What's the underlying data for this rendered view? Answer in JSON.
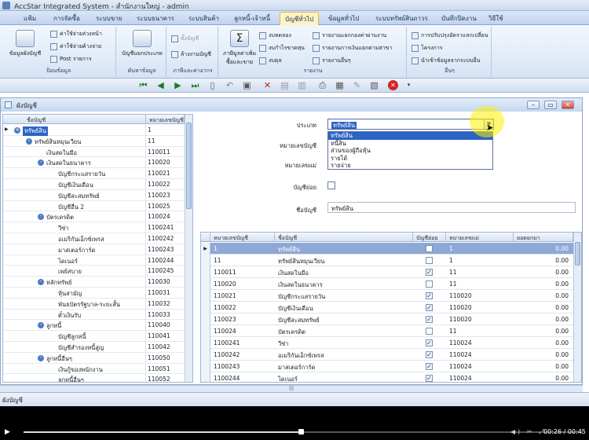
{
  "window": {
    "title": "AccStar Integrated System - สำนักงานใหญ่ - admin"
  },
  "menu": [
    {
      "label": "แฟ้ม"
    },
    {
      "label": "การจัดซื้อ"
    },
    {
      "label": "ระบบขาย"
    },
    {
      "label": "ระบบธนาคาร"
    },
    {
      "label": "ระบบสินค้า"
    },
    {
      "label": "ลูกหนี้-เจ้าหนี้"
    },
    {
      "label": "บัญชีทั่วไป"
    },
    {
      "label": "ข้อมูลทั่วไป"
    },
    {
      "label": "ระบบทรัพย์สินถาวร"
    },
    {
      "label": "บันทึกปิดงาน"
    },
    {
      "label": "วิธีใช้"
    }
  ],
  "ribbon": {
    "g1": {
      "big": "ข้อมูลผังบัญชี",
      "small": [
        "ค่าใช้จ่ายล่วงหน้า",
        "ค่าใช้จ่ายค้างจ่าย",
        "Post รายการ"
      ],
      "label": "ป้อนข้อมูล"
    },
    "g2": {
      "big": "บัญชีแยกประเภท",
      "label": "ค้นหาข้อมูล"
    },
    "g3": {
      "small": [
        "ตั้งบัญชี",
        "ล้างงานบัญชี"
      ],
      "label": "ภาษีและค่าอากร"
    },
    "g4": {
      "big": "ภาษีมูลค่าเพิ่ม ซื้อและขาย",
      "small": [
        "งบทดลอง",
        "งบกำไรขาดทุน",
        "งบดุล"
      ],
      "small2": [
        "รายงานแยกกองค่าผ่านงาน",
        "รายงานการเงินแยกตามสาขา",
        "รายงานอื่นๆ"
      ],
      "label": "รายงาน"
    },
    "g5": {
      "small": [
        "การปรับปรุงอัตราแลกเปลี่ยน",
        "โครงการ",
        "นำเข้าข้อมูลจากระบบอื่น"
      ],
      "label": "อื่นๆ"
    }
  },
  "child": {
    "title": "ผังบัญชี"
  },
  "tree": {
    "headers": [
      "ชื่อบัญชี",
      "หมายเลขบัญชี"
    ],
    "rows": [
      {
        "name": "ทรัพย์สิน",
        "code": "1",
        "level": 0,
        "exp": "+"
      },
      {
        "name": "ทรัพย์สินหมุนเวียน",
        "code": "11",
        "level": 1,
        "exp": "-"
      },
      {
        "name": "เงินสดในมือ",
        "code": "110011",
        "level": 2,
        "exp": ""
      },
      {
        "name": "เงินสดในธนาคาร",
        "code": "110020",
        "level": 2,
        "exp": "-"
      },
      {
        "name": "บัญชีกระแสรายวัน",
        "code": "110021",
        "level": 3,
        "exp": ""
      },
      {
        "name": "บัญชีเงินเดือน",
        "code": "110022",
        "level": 3,
        "exp": ""
      },
      {
        "name": "บัญชีสะสมทรัพย์",
        "code": "110023",
        "level": 3,
        "exp": ""
      },
      {
        "name": "บัญชีอื่น 2",
        "code": "110025",
        "level": 3,
        "exp": ""
      },
      {
        "name": "บัตรเครดิต",
        "code": "110024",
        "level": 2,
        "exp": "-"
      },
      {
        "name": "วีซ่า",
        "code": "1100241",
        "level": 3,
        "exp": ""
      },
      {
        "name": "อเมริกันเอ็กซ์เพรส",
        "code": "1100242",
        "level": 3,
        "exp": ""
      },
      {
        "name": "มาสเตอร์การ์ด",
        "code": "1100243",
        "level": 3,
        "exp": ""
      },
      {
        "name": "ไดเนอร์",
        "code": "1100244",
        "level": 3,
        "exp": ""
      },
      {
        "name": "เพย์สบาย",
        "code": "1100245",
        "level": 3,
        "exp": ""
      },
      {
        "name": "หลักทรัพย์",
        "code": "110030",
        "level": 2,
        "exp": "-"
      },
      {
        "name": "หุ้นสามัญ",
        "code": "110031",
        "level": 3,
        "exp": ""
      },
      {
        "name": "พันธบัตรรัฐบาล-ระยะสั้น",
        "code": "110032",
        "level": 3,
        "exp": ""
      },
      {
        "name": "ตั๋วเงินรับ",
        "code": "110033",
        "level": 3,
        "exp": ""
      },
      {
        "name": "ลูกหนี้",
        "code": "110040",
        "level": 2,
        "exp": "-"
      },
      {
        "name": "บัญชีลูกหนี้",
        "code": "110041",
        "level": 3,
        "exp": ""
      },
      {
        "name": "บัญชีสำรองหนี้สูญ",
        "code": "110042",
        "level": 3,
        "exp": ""
      },
      {
        "name": "ลูกหนี้อื่นๆ",
        "code": "110050",
        "level": 2,
        "exp": "-"
      },
      {
        "name": "เงินกู้ของพนักงาน",
        "code": "110051",
        "level": 3,
        "exp": ""
      },
      {
        "name": "ลูกหนี้อื่นๆ",
        "code": "110052",
        "level": 3,
        "exp": ""
      }
    ]
  },
  "form": {
    "type_label": "ประเภท",
    "type_value": "ทรัพย์สิน",
    "acctno_label": "หมายเลขบัญชี",
    "parent_label": "หมายเลขแม่",
    "control_label": "บัญชีย่อย",
    "name_label": "ชื่อบัญชี",
    "name_value": "ทรัพย์สิน",
    "dropdown": [
      "ทรัพย์สิน",
      "หนี้สิน",
      "ส่วนของผู้ถือหุ้น",
      "รายได้",
      "รายจ่าย"
    ]
  },
  "grid": {
    "headers": [
      "หมายเลขบัญชี",
      "ชื่อบัญชี",
      "บัญชีย่อย",
      "หมายเลขแม่",
      "ยอดยกมา"
    ],
    "rows": [
      {
        "no": "1",
        "name": "ทรัพย์สิน",
        "sub": false,
        "parent": "1",
        "bal": "0.00",
        "sel": true
      },
      {
        "no": "11",
        "name": "ทรัพย์สินหมุนเวียน",
        "sub": false,
        "parent": "1",
        "bal": "0.00"
      },
      {
        "no": "110011",
        "name": "เงินสดในมือ",
        "sub": true,
        "parent": "11",
        "bal": "0.00"
      },
      {
        "no": "110020",
        "name": "เงินสดในธนาคาร",
        "sub": false,
        "parent": "11",
        "bal": "0.00"
      },
      {
        "no": "110021",
        "name": "บัญชีกระแสรายวัน",
        "sub": true,
        "parent": "110020",
        "bal": "0.00"
      },
      {
        "no": "110022",
        "name": "บัญชีเงินเดือน",
        "sub": true,
        "parent": "110020",
        "bal": "0.00"
      },
      {
        "no": "110023",
        "name": "บัญชีสะสมทรัพย์",
        "sub": true,
        "parent": "110020",
        "bal": "0.00"
      },
      {
        "no": "110024",
        "name": "บัตรเครดิต",
        "sub": false,
        "parent": "11",
        "bal": "0.00"
      },
      {
        "no": "1100241",
        "name": "วีซ่า",
        "sub": true,
        "parent": "110024",
        "bal": "0.00"
      },
      {
        "no": "1100242",
        "name": "อเมริกันเอ็กซ์เพรส",
        "sub": true,
        "parent": "110024",
        "bal": "0.00"
      },
      {
        "no": "1100243",
        "name": "มาสเตอร์การ์ด",
        "sub": true,
        "parent": "110024",
        "bal": "0.00"
      },
      {
        "no": "1100244",
        "name": "ไดเนอร์",
        "sub": true,
        "parent": "110024",
        "bal": "0.00"
      }
    ]
  },
  "status": {
    "text": "ผังบัญชี"
  },
  "player": {
    "time": "00:26 / 00:45",
    "progress": 0.5
  }
}
